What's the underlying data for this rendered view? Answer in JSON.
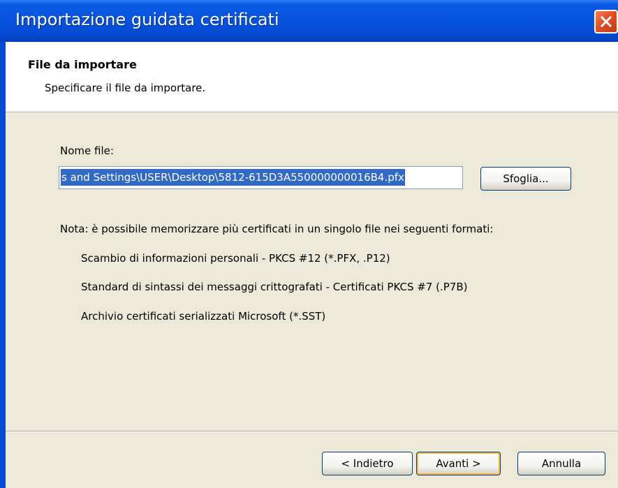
{
  "window": {
    "title": "Importazione guidata certificati"
  },
  "header": {
    "title": "File da importare",
    "subtitle": "Specificare il file da importare."
  },
  "file": {
    "label": "Nome file:",
    "value": "s and Settings\\USER\\Desktop\\5812-615D3A550000000016B4.pfx",
    "browse_label": "Sfoglia..."
  },
  "note": {
    "text": "Nota: è possibile memorizzare più certificati in un singolo file nei seguenti formati:",
    "formats": [
      "Scambio di informazioni personali - PKCS #12 (*.PFX, .P12)",
      "Standard di sintassi dei messaggi crittografati - Certificati PKCS #7 (.P7B)",
      "Archivio certificati serializzati Microsoft (*.SST)"
    ]
  },
  "buttons": {
    "back": "< Indietro",
    "next": "Avanti >",
    "cancel": "Annulla"
  },
  "icons": {
    "close": "close-icon"
  },
  "colors": {
    "titlebar": "#0753dd",
    "close": "#e34f26",
    "selection": "#316ac5",
    "dialog_bg": "#ece9d8"
  }
}
